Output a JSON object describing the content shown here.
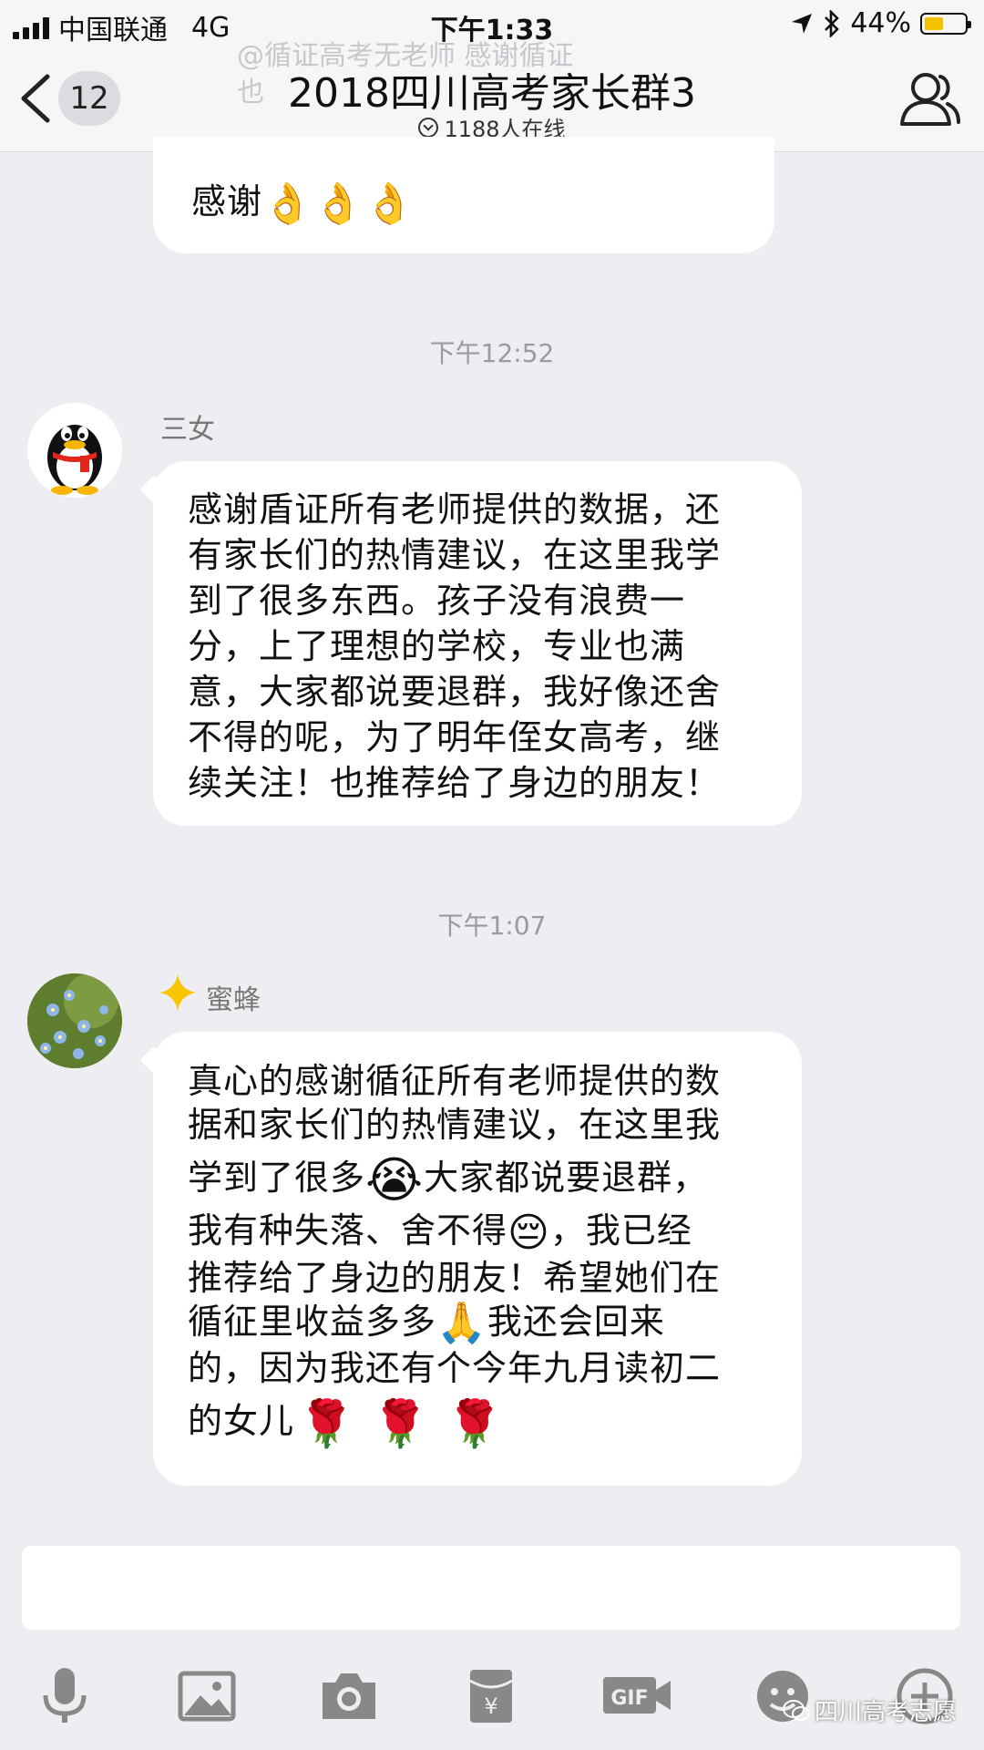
{
  "status_bar": {
    "carrier": "中国联通",
    "network": "4G",
    "time": "下午1:33",
    "battery": "44%",
    "battery_level": 0.44,
    "battery_color": "#f5c300"
  },
  "header": {
    "ghost_text": "@循证高考无老师 感谢循证",
    "ghost_text_2": "也",
    "back_count": "12",
    "title": "2018四川高考家长群3",
    "online": "1188人在线"
  },
  "messages": [
    {
      "type": "bubble",
      "text": "感谢",
      "emoji": [
        "👌",
        "👌",
        "👌"
      ]
    },
    {
      "type": "time",
      "text": "下午12:52"
    },
    {
      "type": "message",
      "sender": "三女",
      "avatar": "qq-penguin",
      "lines": [
        "感谢盾证所有老师提供的数据，还",
        "有家长们的热情建议，在这里我学",
        "到了很多东西。孩子没有浪费一",
        "分，上了理想的学校，专业也满",
        "意，大家都说要退群，我好像还舍",
        "不得的呢，为了明年侄女高考，继",
        "续关注！也推荐给了身边的朋友！"
      ]
    },
    {
      "type": "time",
      "text": "下午1:07"
    },
    {
      "type": "message",
      "sender": "蜜蜂",
      "avatar": "blue-flowers",
      "badge": "star-icon",
      "lines": [
        "真心的感谢循征所有老师提供的数",
        "据和家长们的热情建议，在这里我"
      ],
      "line3": "学到了很多",
      "line3b": "大家都说要退群，",
      "line4": "我有种失落、舍不得",
      "line4b": "，我已经",
      "line5": "推荐给了身边的朋友！希望她们在",
      "line6": "循征里收益多多",
      "line6b": "我还会回来",
      "line7": "的，因为我还有个今年九月读初二",
      "line8": "的女儿",
      "emoji_cry": "😭",
      "emoji_sad": "😔",
      "emoji_pray": "🙏",
      "emoji_rose": "🌹"
    }
  ],
  "toolbar": {
    "icons": [
      "microphone-icon",
      "image-icon",
      "camera-icon",
      "red-packet-icon",
      "gif-icon",
      "emoji-icon",
      "plus-icon"
    ]
  },
  "watermark": "四川高考志愿"
}
